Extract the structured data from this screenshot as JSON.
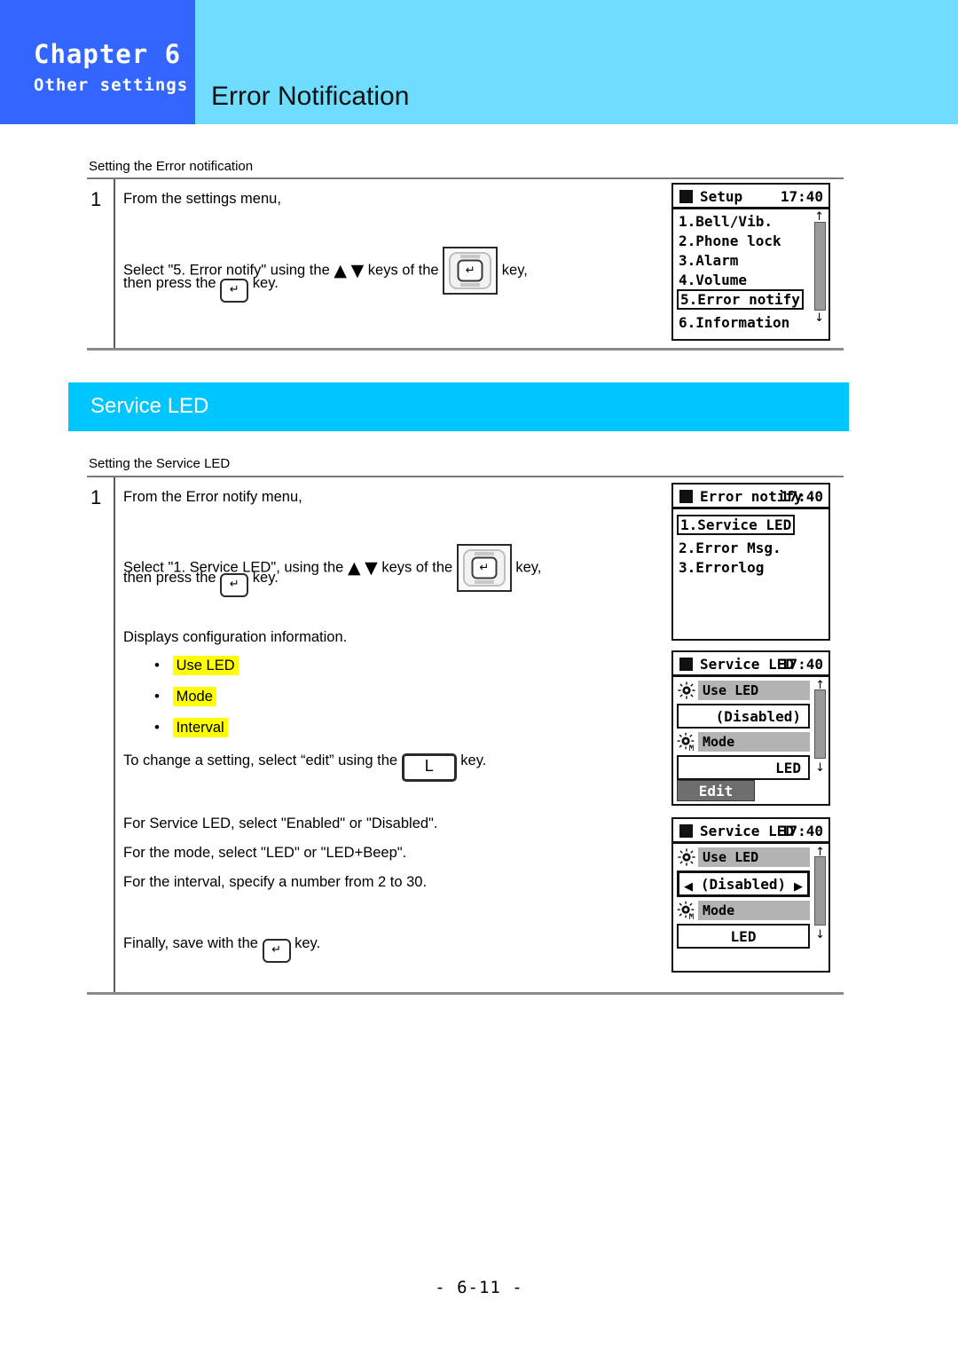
{
  "header": {
    "chapter": "Chapter 6",
    "chapter_subtitle": "Other settings",
    "page_title": "Error Notification",
    "chapter_bg": "#3366FF",
    "banner_bg": "#6FDDFF"
  },
  "section1": {
    "caption": "Setting the Error notification",
    "step_number": "1",
    "line1": "From the settings menu,",
    "line2_a": "Select \"5. Error notify\" using the",
    "line2_b": "keys of the",
    "line2_c": "key,",
    "line3_a": "then press the",
    "line3_b": "key.",
    "nav_key_glyph": "↵",
    "enter_key_glyph": "↵",
    "arrow_up": "▲",
    "arrow_down": "▼"
  },
  "service_led_banner": {
    "title": "Service LED",
    "bg": "#00C6FF"
  },
  "section2": {
    "caption": "Setting the Service LED",
    "step_number": "1",
    "line1": "From the Error notify menu,",
    "line2_a": "Select \"1. Service LED\", using the",
    "line2_b": "keys of the",
    "line2_c": "key,",
    "line3_a": "then press the",
    "line3_b": "key.",
    "line4": "Displays configuration information.",
    "bullets": [
      {
        "label": "Use LED",
        "highlight": true
      },
      {
        "label": "Mode",
        "highlight": true
      },
      {
        "label": "Interval",
        "highlight": true
      }
    ],
    "line5_a": "To change a setting, select “edit” using the",
    "line5_b": "key.",
    "soft_key_label": "L",
    "line6": "For Service LED, select \"Enabled\" or \"Disabled\".",
    "line7": "For the mode, select \"LED\" or \"LED+Beep\".",
    "line8": "For the interval, specify a number from 2 to 30.",
    "line9_a": "Finally, save with the",
    "line9_b": "key.",
    "enter_key_glyph": "↵",
    "arrow_up": "▲",
    "arrow_down": "▼"
  },
  "screens": {
    "setup": {
      "title": "Setup",
      "clock": "17:40",
      "items": [
        "1.Bell/Vib.",
        "2.Phone lock",
        "3.Alarm",
        "4.Volume",
        "5.Error notify",
        "6.Information"
      ],
      "selected_index": 4,
      "scroll_up_glyph": "↑",
      "scroll_down_glyph": "↓"
    },
    "error_notify": {
      "title": "Error notify",
      "clock": "17:40",
      "items": [
        "1.Service LED",
        "2.Error Msg.",
        "3.Errorlog"
      ],
      "selected_index": 0
    },
    "service_led_view": {
      "title": "Service LED",
      "clock": "17:40",
      "rows": [
        {
          "icon": "led-sun-icon",
          "label": "Use LED",
          "value": "(Disabled)",
          "align": "right"
        },
        {
          "icon": "led-sun-mode-icon",
          "label": "Mode",
          "value": "LED",
          "align": "right"
        }
      ],
      "softkey": "Edit",
      "scroll_up_glyph": "↑",
      "scroll_down_glyph": "↓"
    },
    "service_led_edit": {
      "title": "Service LED",
      "clock": "17:40",
      "rows": [
        {
          "icon": "led-sun-icon",
          "label": "Use LED",
          "value": "(Disabled)",
          "align": "center",
          "editing": true
        },
        {
          "icon": "led-sun-mode-icon",
          "label": "Mode",
          "value": "LED",
          "align": "center",
          "editing": false
        }
      ],
      "left_arrow_glyph": "◀",
      "right_arrow_glyph": "▶",
      "scroll_up_glyph": "↑",
      "scroll_down_glyph": "↓"
    }
  },
  "footer": {
    "page_label": "- 6-11 -"
  }
}
